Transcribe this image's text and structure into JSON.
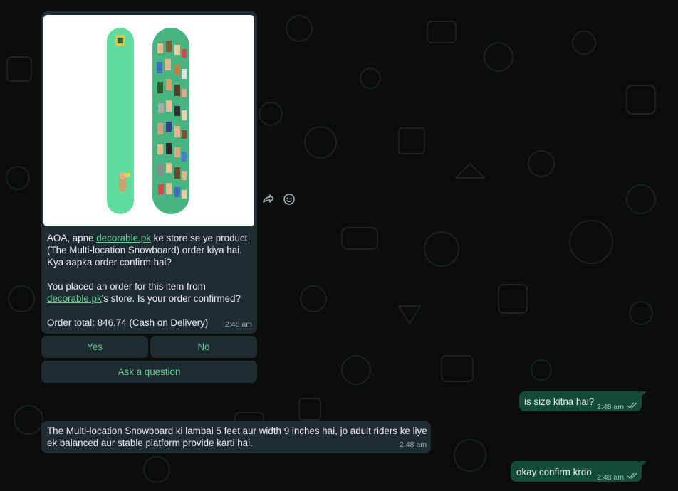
{
  "colors": {
    "background": "#0b0d0d",
    "incoming_bubble": "#202c33",
    "outgoing_bubble": "#144d37",
    "link": "#6fcf97",
    "quick_reply_text": "#5fcf8f",
    "board_green": "#5edc9e",
    "read_ticks": "#9fb0b6"
  },
  "product_message": {
    "image_alt": "The Multi-location Snowboard",
    "text_line1_prefix": "AOA, apne ",
    "link_text": "decorable.pk",
    "text_line1_suffix": " ke store se ye product",
    "text_line2": "(The Multi-location Snowboard) order kiya hai.",
    "text_line3": "Kya aapka order confirm hai?",
    "text_line4": "You placed an order for this item from",
    "text_line5_suffix": "'s store. Is your order confirmed?",
    "order_total": "Order total: 846.74 (Cash on Delivery)",
    "time": "2:48 am",
    "forward_icon": "forward-icon",
    "emoji_icon": "emoji-react-icon"
  },
  "quick_replies": {
    "yes": "Yes",
    "no": "No",
    "ask": "Ask a question"
  },
  "messages": [
    {
      "direction": "out",
      "text": "is size kitna hai?",
      "time": "2:48 am",
      "status": "read"
    },
    {
      "direction": "in",
      "line1": "The Multi-location Snowboard ki lambai 5 feet aur width 9 inches hai, jo adult riders ke liye",
      "line2": "ek balanced aur stable platform provide karti hai.",
      "time": "2:48 am"
    },
    {
      "direction": "out",
      "text": "okay confirm krdo",
      "time": "2:48 am",
      "status": "read"
    }
  ]
}
